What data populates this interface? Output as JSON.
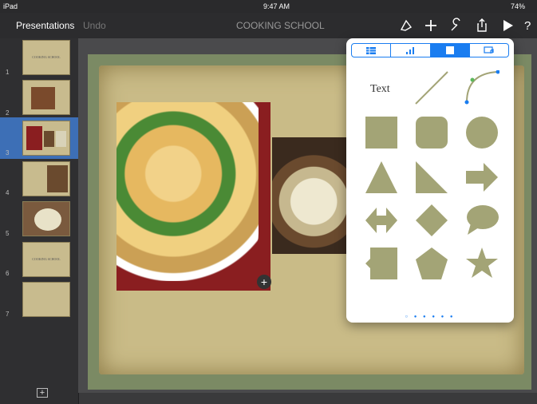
{
  "status": {
    "device": "iPad",
    "time": "9:47 AM",
    "battery": "74%"
  },
  "toolbar": {
    "presentations_label": "Presentations",
    "undo_label": "Undo",
    "document_title": "COOKING SCHOOL"
  },
  "sidebar": {
    "slides": [
      {
        "num": "1",
        "title": "COOKING SCHOOL"
      },
      {
        "num": "2"
      },
      {
        "num": "3"
      },
      {
        "num": "4"
      },
      {
        "num": "5"
      },
      {
        "num": "6",
        "title": "COOKING SCHOOL"
      },
      {
        "num": "7"
      }
    ],
    "selected_slide": "3",
    "add_slide_icon": "plus-box-icon"
  },
  "canvas": {
    "add_button_icon": "plus-circle-icon"
  },
  "popover": {
    "tabs": [
      {
        "name": "table",
        "icon": "table-icon"
      },
      {
        "name": "chart",
        "icon": "chart-icon"
      },
      {
        "name": "shape",
        "icon": "shape-icon",
        "active": true
      },
      {
        "name": "media",
        "icon": "media-icon"
      }
    ],
    "text_label": "Text",
    "shapes": [
      "text",
      "line",
      "curve",
      "square",
      "rounded-square",
      "circle",
      "triangle",
      "right-triangle",
      "arrow",
      "double-arrow",
      "diamond",
      "speech-bubble",
      "callout-square",
      "pentagon",
      "star"
    ],
    "page_dots": "○ ● ● ● ● ●"
  },
  "colors": {
    "accent": "#1a7df0",
    "shape_fill": "#a3a476",
    "toolbar_bg": "#2c2c2e"
  }
}
